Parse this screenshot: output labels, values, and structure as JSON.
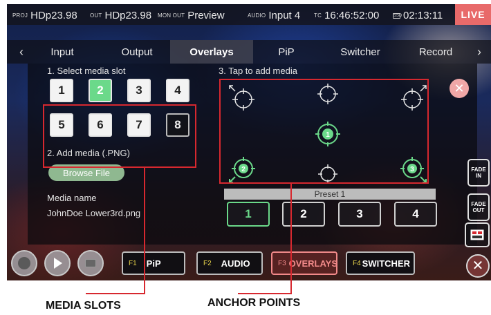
{
  "status_bar": {
    "proj_label": "PROJ",
    "proj_value": "HDp23.98",
    "out_label": "OUT",
    "out_value": "HDp23.98",
    "monout_label": "MON OUT",
    "monout_value": "Preview",
    "audio_label": "AUDIO",
    "audio_value": "Input 4",
    "tc_label": "TC",
    "tc_value": "16:46:52:00",
    "ssd_label": "SSD",
    "ssd_value": "02:13:11",
    "live_label": "LIVE"
  },
  "tabs": [
    "Input",
    "Output",
    "Overlays",
    "PiP",
    "Switcher",
    "Record"
  ],
  "active_tab": "Overlays",
  "media": {
    "step1_title": "1. Select media slot",
    "slots": [
      "1",
      "2",
      "3",
      "4",
      "5",
      "6",
      "7",
      "8"
    ],
    "selected_slot": "2",
    "step2_title": "2. Add media (.PNG)",
    "browse_label": "Browse File",
    "media_name_label": "Media name",
    "media_name_value": "JohnDoe Lower3rd.png"
  },
  "anchors": {
    "step3_title": "3. Tap to add media",
    "placed_labels": [
      "1",
      "2",
      "3"
    ],
    "preset_title": "Preset 1",
    "presets": [
      "1",
      "2",
      "3",
      "4"
    ],
    "selected_preset": "1"
  },
  "side_buttons": {
    "fade_in": "FADE IN",
    "fade_out": "FADE OUT"
  },
  "bottom_bar": {
    "f1_key": "F1",
    "f1_label": "PiP",
    "f2_key": "F2",
    "f2_label": "AUDIO",
    "f3_key": "F3",
    "f3_label": "OVERLAYS",
    "f4_key": "F4",
    "f4_label": "SWITCHER"
  },
  "callouts": {
    "media_slots": "MEDIA SLOTS",
    "anchor_points": "ANCHOR POINTS"
  },
  "colors": {
    "accent_green": "#6bd98a",
    "live_red": "#e86a6a",
    "callout_red": "#d7282f",
    "function_key_yellow": "#e8d44a"
  }
}
